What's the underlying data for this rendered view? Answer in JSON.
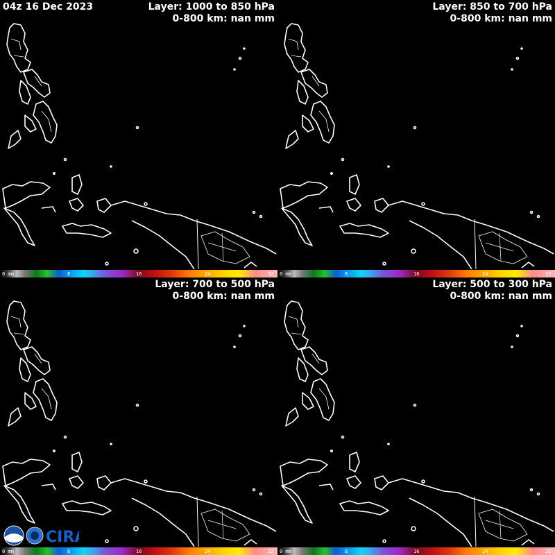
{
  "header": {
    "timestamp": "04z 16 Dec 2023"
  },
  "panels": [
    {
      "layer": "Layer: 1000 to 850 hPa",
      "stat": "0-800 km: nan mm"
    },
    {
      "layer": "Layer: 850 to 700 hPa",
      "stat": "0-800 km: nan mm"
    },
    {
      "layer": "Layer: 700 to 500 hPa",
      "stat": "0-800 km: nan mm"
    },
    {
      "layer": "Layer: 500 to 300 hPa",
      "stat": "0-800 km: nan mm"
    }
  ],
  "colorbar": {
    "labels": [
      "0 mm",
      "8",
      "16",
      "24",
      "32"
    ]
  },
  "logo": {
    "text": "CIRA"
  },
  "colors": {
    "background": "#000000",
    "coastline": "#ffffff"
  }
}
